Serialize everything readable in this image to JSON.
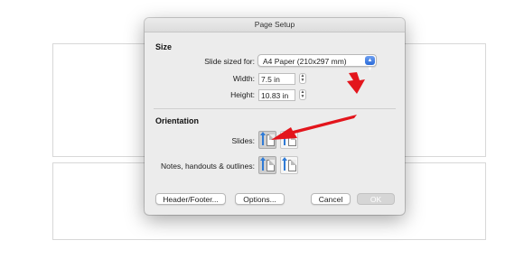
{
  "dialog": {
    "title": "Page Setup",
    "size_section": {
      "heading": "Size",
      "slide_sized_for_label": "Slide sized for:",
      "slide_sized_for_value": "A4 Paper (210x297 mm)",
      "width_label": "Width:",
      "width_value": "7.5 in",
      "height_label": "Height:",
      "height_value": "10.83 in"
    },
    "orientation_section": {
      "heading": "Orientation",
      "slides_label": "Slides:",
      "notes_label": "Notes, handouts & outlines:",
      "slides_selected": "portrait",
      "notes_selected": "portrait"
    },
    "buttons": {
      "header_footer": "Header/Footer...",
      "options": "Options...",
      "cancel": "Cancel",
      "ok": "OK"
    }
  },
  "icons": {
    "popup_chevron": "up-down-chevron-icon",
    "portrait": "portrait-orientation-icon",
    "landscape": "landscape-orientation-icon",
    "annotation": "red-arrow-icon"
  },
  "colors": {
    "accent": "#2a6bd9",
    "annotation_arrow": "#e3151c",
    "dialog_bg": "#ececec"
  }
}
